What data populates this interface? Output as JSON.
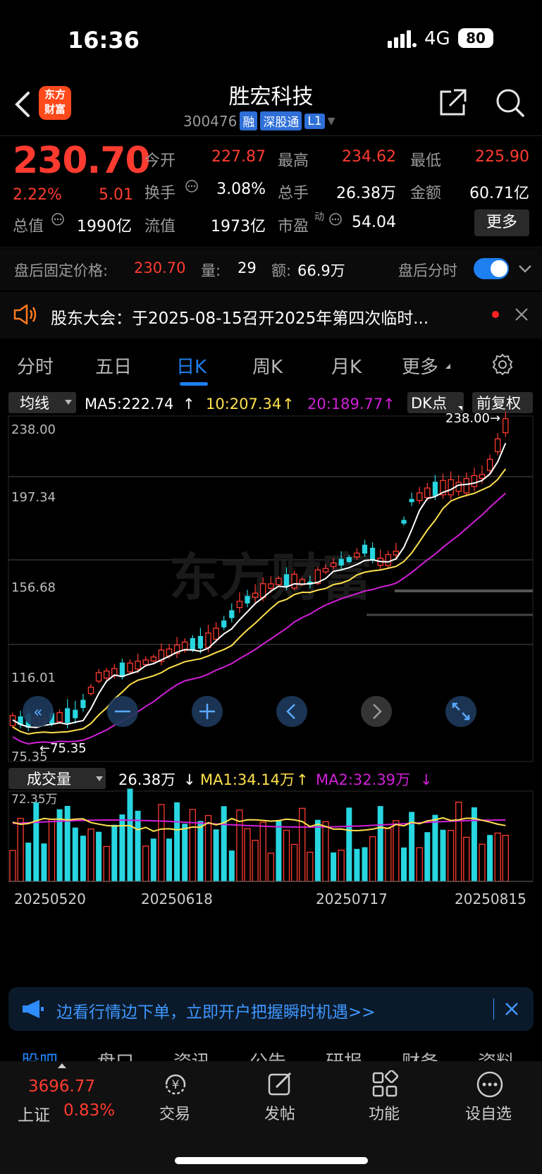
{
  "status_bar": {
    "time": "16:36",
    "network": "4G",
    "battery": "80"
  },
  "header": {
    "app_logo_line1": "东方",
    "app_logo_line2": "财富",
    "title": "胜宏科技",
    "code": "300476",
    "tags": [
      "融",
      "深股通",
      "L1"
    ]
  },
  "quote": {
    "price": "230.70",
    "change_pct": "2.22%",
    "change_amt": "5.01",
    "open_label": "今开",
    "open": "227.87",
    "high_label": "最高",
    "high": "234.62",
    "low_label": "最低",
    "low": "225.90",
    "turnover_label": "换手",
    "turnover": "3.08%",
    "volume_label": "总手",
    "volume": "26.38万",
    "amount_label": "金额",
    "amount": "60.71亿",
    "mktcap_label": "总值",
    "mktcap": "1990亿",
    "float_label": "流值",
    "float": "1973亿",
    "pe_label": "市盈",
    "pe_sup": "动",
    "pe": "54.04",
    "more_button": "更多"
  },
  "after_hours": {
    "label": "盘后固定价格:",
    "price": "230.70",
    "vol_label": "量:",
    "vol": "29",
    "amt_label": "额:",
    "amt": "66.9万",
    "toggle_label": "盘后分时"
  },
  "notice": {
    "text": "股东大会：于2025-08-15召开2025年第四次临时..."
  },
  "tabs": [
    "分时",
    "五日",
    "日K",
    "周K",
    "月K",
    "更多"
  ],
  "active_tab": "日K",
  "kline": {
    "indicator_select": "均线",
    "ma5": "MA5:222.74",
    "ma10": "10:207.34",
    "ma20": "20:189.77",
    "dk_button": "DK点",
    "adjust_button": "前复权",
    "price_ticks": [
      "238.00",
      "197.34",
      "156.68",
      "116.01",
      "75.35"
    ],
    "max_label": "238.00→",
    "min_label": "←75.35",
    "watermark": "东方财富"
  },
  "volume_panel": {
    "select": "成交量",
    "value": "26.38万",
    "ma1": "MA1:34.14万",
    "ma2": "MA2:32.39万",
    "top_tick": "72.35万",
    "dates": [
      "20250520",
      "20250618",
      "20250717",
      "20250815"
    ]
  },
  "promo": {
    "text": "边看行情边下单，立即开户把握瞬时机遇>>"
  },
  "subnav_partial": [
    "股吧",
    "盘口",
    "资讯",
    "公告",
    "研报",
    "财务",
    "资料"
  ],
  "bottom_nav": {
    "index_value": "3696.77",
    "index_name": "上证",
    "index_pct": "0.83%",
    "items": [
      "交易",
      "发帖",
      "功能",
      "设自选"
    ]
  },
  "colors": {
    "up": "#ff3b30",
    "down": "#27d6e0",
    "ma5": "#ffffff",
    "ma10": "#ffe14d",
    "ma20": "#d21fd8",
    "accent": "#1e7ff0"
  }
}
